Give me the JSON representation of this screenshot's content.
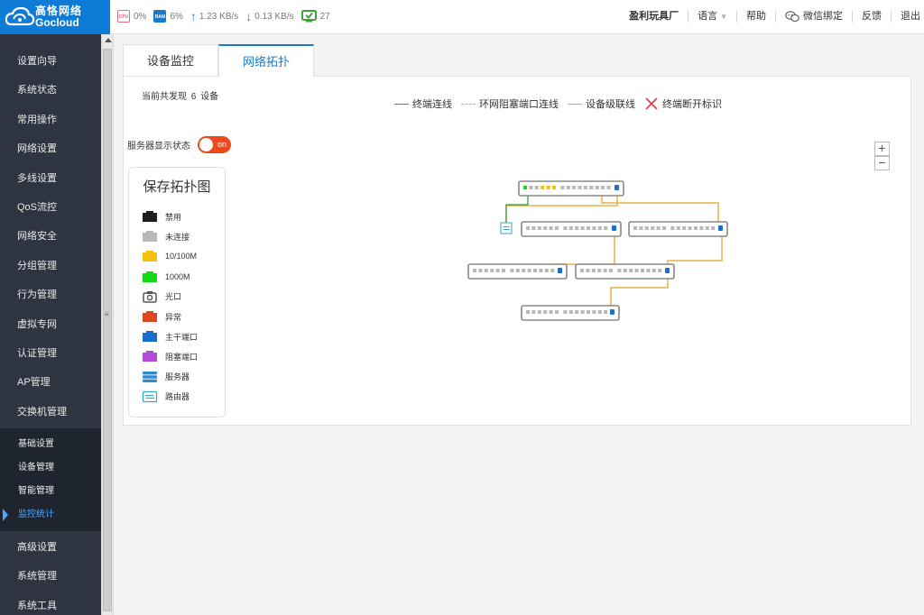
{
  "logo": {
    "cn": "高恪网络",
    "en": "Gocloud"
  },
  "stats": {
    "cpu_chip": "CPU",
    "cpu": "0%",
    "ram_chip": "RAM",
    "ram": "6%",
    "upload": "1.23 KB/s",
    "download": "0.13 KB/s",
    "online": "27"
  },
  "topnav": {
    "device_name": "盈利玩具厂",
    "language": "语言",
    "help": "帮助",
    "wechat": "微信绑定",
    "feedback": "反馈",
    "logout": "退出"
  },
  "sidebar": {
    "items": [
      "设置向导",
      "系统状态",
      "常用操作",
      "网络设置",
      "多线设置",
      "QoS流控",
      "网络安全",
      "分组管理",
      "行为管理",
      "虚拟专网",
      "认证管理",
      "AP管理",
      "交换机管理"
    ],
    "sub_items": [
      "基础设置",
      "设备管理",
      "智能管理",
      "监控统计"
    ],
    "active_sub": "监控统计",
    "items_after": [
      "高级设置",
      "系统管理",
      "系统工具"
    ]
  },
  "tabs": [
    "设备监控",
    "网络拓扑"
  ],
  "active_tab": "网络拓扑",
  "device_count": {
    "prefix": "当前共发现",
    "count": "6",
    "suffix": "设备"
  },
  "legend": [
    {
      "label": "终端连线",
      "color": "#3a9a3a",
      "style": "solid"
    },
    {
      "label": "环网阻塞端口连线",
      "color": "#e8a126",
      "style": "dashed"
    },
    {
      "label": "设备级联线",
      "color": "#e8a126",
      "style": "solid"
    },
    {
      "label": "终端断开标识",
      "color": "#e83a3a",
      "style": "cross"
    }
  ],
  "server_toggle": {
    "label": "服务器显示状态",
    "state": "on"
  },
  "zoom": {
    "in": "+",
    "out": "−"
  },
  "port_legend": {
    "title": "保存拓扑图",
    "items": [
      {
        "label": "禁用",
        "color": "#1e1e1e",
        "icon": "port-icon"
      },
      {
        "label": "未连接",
        "color": "#b8b8b8",
        "icon": "port-icon"
      },
      {
        "label": "10/100M",
        "color": "#f4c20d",
        "icon": "port-icon"
      },
      {
        "label": "1000M",
        "color": "#14d914",
        "icon": "port-icon"
      },
      {
        "label": "光口",
        "color": "#555555",
        "icon": "camera-icon"
      },
      {
        "label": "异常",
        "color": "#e0461e",
        "icon": "port-icon"
      },
      {
        "label": "主干端口",
        "color": "#1a6fcc",
        "icon": "port-icon"
      },
      {
        "label": "阻塞端口",
        "color": "#b44ad8",
        "icon": "port-icon"
      },
      {
        "label": "服务器",
        "color": "#2f8bd6",
        "icon": "server-icon"
      },
      {
        "label": "路由器",
        "color": "#35a6c4",
        "icon": "router-icon"
      }
    ]
  }
}
